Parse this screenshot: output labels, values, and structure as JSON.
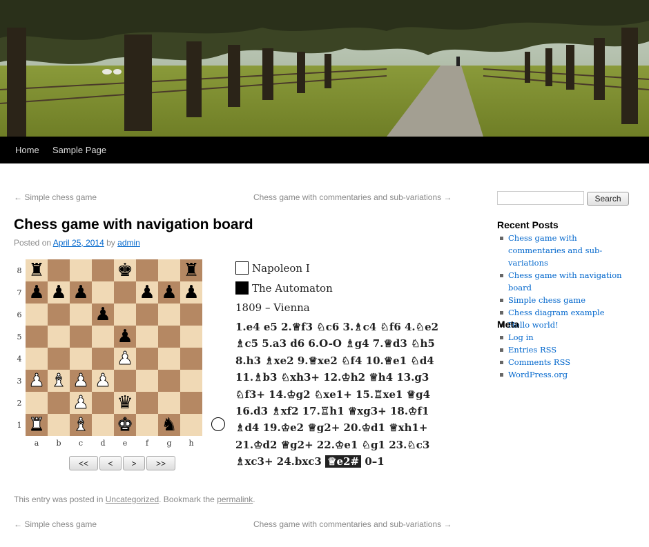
{
  "nav": {
    "items": [
      "Home",
      "Sample Page"
    ]
  },
  "post_nav": {
    "prev": "Simple chess game",
    "next": "Chess game with commentaries and sub-variations",
    "prev_arrow": "←",
    "next_arrow": "→"
  },
  "post": {
    "title": "Chess game with navigation board",
    "posted_on": "Posted on",
    "date": "April 25, 2014",
    "by": "by",
    "author": "admin"
  },
  "board": {
    "ranks": [
      "8",
      "7",
      "6",
      "5",
      "4",
      "3",
      "2",
      "1"
    ],
    "files": [
      "a",
      "b",
      "c",
      "d",
      "e",
      "f",
      "g",
      "h"
    ],
    "position": [
      [
        "br",
        "",
        "",
        "",
        "bk",
        "",
        "",
        "br"
      ],
      [
        "bp",
        "bp",
        "bp",
        "",
        "",
        "bp",
        "bp",
        "bp"
      ],
      [
        "",
        "",
        "",
        "bp",
        "",
        "",
        "",
        ""
      ],
      [
        "",
        "",
        "",
        "",
        "bp",
        "",
        "",
        ""
      ],
      [
        "",
        "",
        "",
        "",
        "wp",
        "",
        "",
        ""
      ],
      [
        "wp",
        "wb",
        "wp",
        "wp",
        "",
        "",
        "",
        ""
      ],
      [
        "",
        "",
        "wp",
        "",
        "bq",
        "",
        "",
        ""
      ],
      [
        "wr",
        "",
        "wb",
        "",
        "wk",
        "",
        "bn",
        ""
      ]
    ],
    "buttons": [
      "<<",
      "<",
      ">",
      ">>"
    ]
  },
  "game": {
    "white": "Napoleon I",
    "black": "The Automaton",
    "event": "1809 – Vienna",
    "moves_before": "1.e4 e5 2.♕f3 ♘c6 3.♗c4 ♘f6 4.♘e2 ♗c5 5.a3 d6 6.O-O ♗g4 7.♕d3 ♘h5 8.h3 ♗xe2 9.♕xe2 ♘f4 10.♕e1 ♘d4 11.♗b3 ♘xh3+ 12.♔h2 ♕h4 13.g3 ♘f3+ 14.♔g2 ♘xe1+ 15.♖xe1 ♕g4 16.d3 ♗xf2 17.♖h1 ♕xg3+ 18.♔f1 ♗d4 19.♔e2 ♕g2+ 20.♔d1 ♕xh1+ 21.♔d2 ♕g2+ 22.♔e1 ♘g1 23.♘c3 ♗xc3+ 24.bxc3",
    "current_move": "♕e2#",
    "result": "0–1"
  },
  "footer": {
    "text1": "This entry was posted in",
    "category": "Uncategorized",
    "text2": ". Bookmark the",
    "permalink": "permalink",
    "text3": "."
  },
  "sidebar": {
    "search_button": "Search",
    "recent_title": "Recent Posts",
    "recent_posts": [
      "Chess game with commentaries and sub-variations",
      "Chess game with navigation board",
      "Simple chess game",
      "Chess diagram example",
      "Hello world!"
    ],
    "meta_title": "Meta",
    "meta_links": [
      "Log in",
      "Entries RSS",
      "Comments RSS",
      "WordPress.org"
    ]
  },
  "colors": {
    "light_square": "#f0d9b5",
    "dark_square": "#b58863",
    "link": "#0066cc",
    "nav_bg": "#000000"
  }
}
